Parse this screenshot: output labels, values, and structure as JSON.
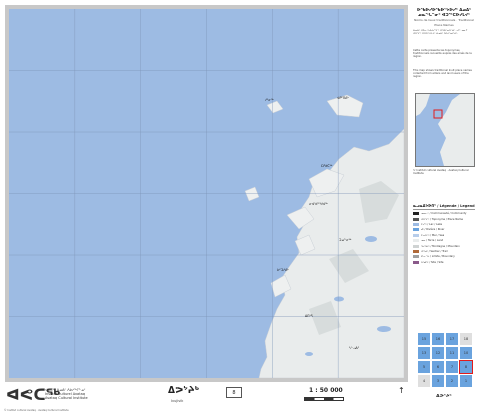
{
  "colors": {
    "water": "#9dbbe3",
    "land": "#e9ecec",
    "graticule": "#7f96b8",
    "index_blue": "#6aa3de",
    "index_active": "#e21b1b"
  },
  "map": {
    "grid_lines": 6
  },
  "sidebar": {
    "title": "ᐅᖃᐅᓯᐅᖃᐅᔾᔭᐅᓯᑦ ᐃᓄᐃᑦ ᓄᓇᖓᓐᓂᑦ ᐊᑐᖅᑕᐅᓯᒪᔪᑦ",
    "subtitle": "Noms de lieux traditionnels · Traditional Place Names",
    "paragraphs": [
      "ᐃᓄᐃᑦ ᐊᐅᓚᔾᔭᐃᒍᓯᖏᑦ ᐊᑐᐃᓐᓇᐅᖁᓪᓗᒋᑦ ᓄᓇᒥ ᐊᑎᖏᑦ ᑎᑎᕋᖅᓯᒪᔪᑦ ᐃᓄᐃᑦ ᐱᐅᓯᕐᓂᑎᒍᑦ.",
      "Cette carte présente les toponymes traditionnels recueillis auprès des aînés de la région.",
      "This map shows traditional Inuit place names collected from elders and land users of the region."
    ],
    "legend_title": "ᓇᓗᓇᐃᔭᐅᑎᑦ / Légende / Legend",
    "legend": [
      {
        "label": "ᓄᓇᓕᑦ / Communauté / Community",
        "color": "#222222"
      },
      {
        "label": "ᐊᑎᖏᑦ / Toponyme / Place Name",
        "color": "#555555"
      },
      {
        "label": "ᑕᓯᖅ / Lac / Lake",
        "color": "#9dbbe3"
      },
      {
        "label": "ᑰᒃ / Rivière / River",
        "color": "#6aa3de"
      },
      {
        "label": "ᑕᕆᐅᖅ / Mer / Sea",
        "color": "#b7cdea"
      },
      {
        "label": "ᓄᓇ / Terre / Land",
        "color": "#e9ecec"
      },
      {
        "label": "ᖃᖅᑲᖅ / Montagne / Mountain",
        "color": "#cfd3d3"
      },
      {
        "label": "ᐊᖅᑯᑦ / Sentier / Trail",
        "color": "#b06a3a"
      },
      {
        "label": "ᑭᒡᓕᖓ / Limite / Boundary",
        "color": "#a0a0a0"
      },
      {
        "label": "ᐱᖁᑎᑦ / Site / Site",
        "color": "#8a5a8a"
      }
    ],
    "index_numbers": [
      "15",
      "16",
      "17",
      "18",
      "13",
      "12",
      "11",
      "10",
      "5",
      "6",
      "7",
      "8",
      "4",
      "3",
      "2",
      "1"
    ],
    "active_index": "8",
    "sheet_name": "ᐃᕗᔾᔨᒃ"
  },
  "footer": {
    "logo": "ᐊᕙᑕᖅ",
    "institute": [
      "ᐊᕙᑕᖅ ᐃᓄᐃᑦ ᐱᐅᓯᖏᓐᓄᑦ",
      "Institut culturel Avataq",
      "Avataq Cultural Institute"
    ],
    "title_syllabic": "ᐃᕗᔾᔨᒃ",
    "title_latin": "Ivujivik",
    "sheet_number": "8",
    "scale": "1 : 50 000",
    "north_arrow": "↑",
    "copyright": "© Institut culturel Avataq · Avataq Cultural Institute"
  }
}
